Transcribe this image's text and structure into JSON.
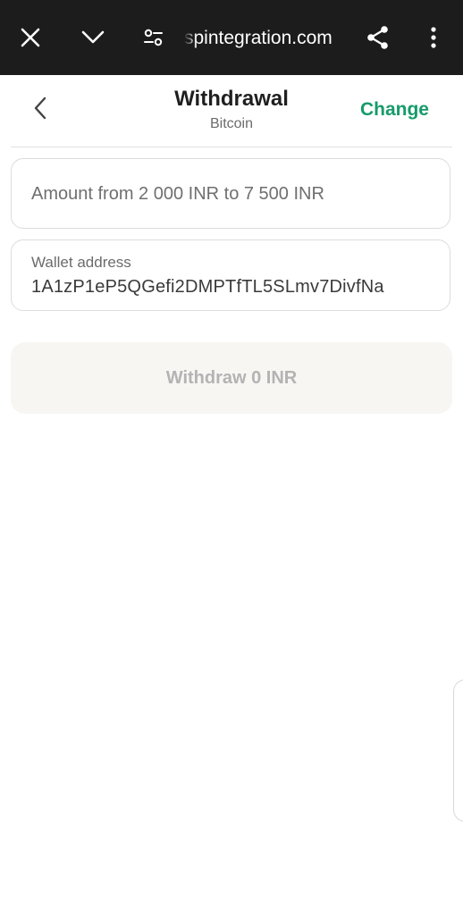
{
  "browser": {
    "url": "spintegration.com",
    "icons": {
      "close": "close-icon",
      "chevron": "chevron-down-icon",
      "tune": "tune-icon",
      "share": "share-icon",
      "more": "more-vert-icon"
    }
  },
  "header": {
    "title": "Withdrawal",
    "subtitle": "Bitcoin",
    "change_label": "Change"
  },
  "form": {
    "amount_placeholder": "Amount from 2 000 INR to 7 500 INR",
    "wallet_label": "Wallet address",
    "wallet_value": "1A1zP1eP5QGefi2DMPTfTL5SLmv7DivfNa"
  },
  "withdraw_button": "Withdraw 0 INR",
  "colors": {
    "toolbar": "#1c1c1c",
    "accent": "#169b6b",
    "disabled_button_bg": "#f7f6f3"
  }
}
